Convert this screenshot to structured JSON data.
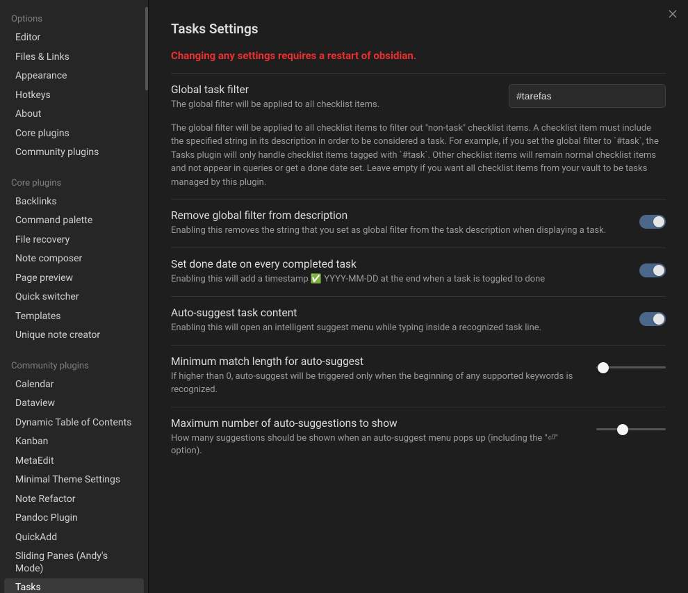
{
  "sidebar": {
    "groups": [
      {
        "header": "Options",
        "items": [
          "Editor",
          "Files & Links",
          "Appearance",
          "Hotkeys",
          "About",
          "Core plugins",
          "Community plugins"
        ]
      },
      {
        "header": "Core plugins",
        "items": [
          "Backlinks",
          "Command palette",
          "File recovery",
          "Note composer",
          "Page preview",
          "Quick switcher",
          "Templates",
          "Unique note creator"
        ]
      },
      {
        "header": "Community plugins",
        "items": [
          "Calendar",
          "Dataview",
          "Dynamic Table of Contents",
          "Kanban",
          "MetaEdit",
          "Minimal Theme Settings",
          "Note Refactor",
          "Pandoc Plugin",
          "QuickAdd",
          "Sliding Panes (Andy's Mode)",
          "Tasks"
        ]
      }
    ],
    "active": "Tasks"
  },
  "main": {
    "title": "Tasks Settings",
    "warning": "Changing any settings requires a restart of obsidian.",
    "settings": {
      "globalFilter": {
        "name": "Global task filter",
        "desc": "The global filter will be applied to all checklist items.",
        "value": "#tarefas",
        "extra": "The global filter will be applied to all checklist items to filter out \"non-task\" checklist items. A checklist item must include the specified string in its description in order to be considered a task. For example, if you set the global filter to `#task`, the Tasks plugin will only handle checklist items tagged with `#task`. Other checklist items will remain normal checklist items and not appear in queries or get a done date set. Leave empty if you want all checklist items from your vault to be tasks managed by this plugin."
      },
      "removeFilter": {
        "name": "Remove global filter from description",
        "desc": "Enabling this removes the string that you set as global filter from the task description when displaying a task.",
        "on": true
      },
      "doneDate": {
        "name": "Set done date on every completed task",
        "desc": "Enabling this will add a timestamp ✅ YYYY-MM-DD at the end when a task is toggled to done",
        "on": true
      },
      "autoSuggest": {
        "name": "Auto-suggest task content",
        "desc": "Enabling this will open an intelligent suggest menu while typing inside a recognized task line.",
        "on": true
      },
      "minMatch": {
        "name": "Minimum match length for auto-suggest",
        "desc": "If higher than 0, auto-suggest will be triggered only when the beginning of any supported keywords is recognized.",
        "sliderPct": 10
      },
      "maxSugg": {
        "name": "Maximum number of auto-suggestions to show",
        "desc": "How many suggestions should be shown when an auto-suggest menu pops up (including the \"⏎\" option).",
        "sliderPct": 38
      }
    }
  }
}
